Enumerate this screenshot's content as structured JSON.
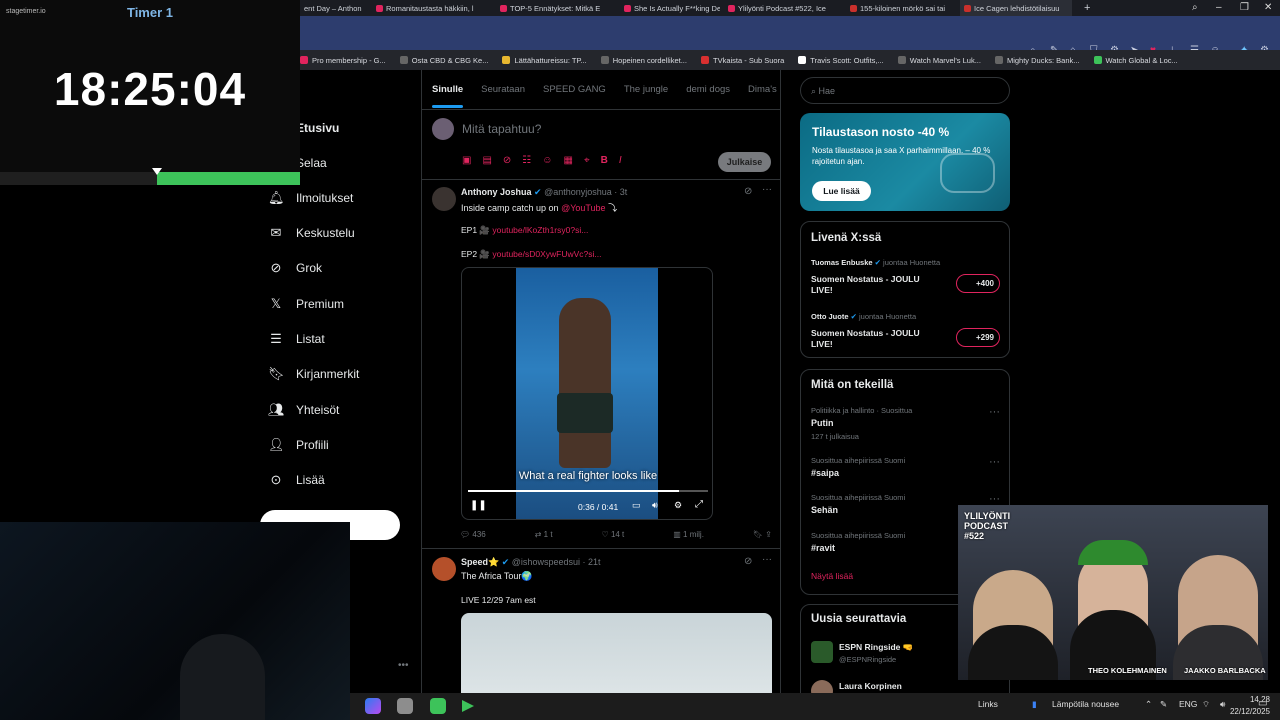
{
  "browser": {
    "tabs": [
      {
        "label": "ent Day – Anthon"
      },
      {
        "label": "Romanitaustasta häkkiin, l"
      },
      {
        "label": "TOP-5 Ennätykset: Mitkä E"
      },
      {
        "label": "She Is Actually F**king De"
      },
      {
        "label": "Ylilyönti Podcast #522, Ice"
      },
      {
        "label": "155-kiloinen mörkö sai tai"
      },
      {
        "label": "Ice Cagen lehdistötilaisuu"
      }
    ],
    "new_tab": "+",
    "bookmarks": [
      "Pro membership - G...",
      "Osta CBD & CBG Ke...",
      "Lättähattureissu: TP...",
      "Hopeinen cordelliket...",
      "TVkaista - Sub Suora",
      "Travis Scott: Outfits,...",
      "Watch Marvel's Luk...",
      "Mighty Ducks: Bank...",
      "Watch Global & Loc..."
    ]
  },
  "timer_overlay": {
    "logo": "stagetimer.io",
    "title": "Timer 1",
    "time": "18:25:04",
    "progress_fraction": 0.48
  },
  "sidebar": {
    "items": [
      {
        "label": "Etusivu",
        "icon": "home-icon"
      },
      {
        "label": "Selaa",
        "icon": "search-icon"
      },
      {
        "label": "Ilmoitukset",
        "icon": "bell-icon"
      },
      {
        "label": "Keskustelu",
        "icon": "mail-icon"
      },
      {
        "label": "Grok",
        "icon": "grok-icon"
      },
      {
        "label": "Premium",
        "icon": "x-logo-icon"
      },
      {
        "label": "Listat",
        "icon": "list-icon"
      },
      {
        "label": "Kirjanmerkit",
        "icon": "bookmark-icon"
      },
      {
        "label": "Yhteisöt",
        "icon": "people-icon"
      },
      {
        "label": "Profiili",
        "icon": "person-icon"
      },
      {
        "label": "Lisää",
        "icon": "more-circle-icon"
      }
    ]
  },
  "feed": {
    "tabs": [
      "Sinulle",
      "Seurataan",
      "SPEED GANG",
      "The jungle",
      "demi dogs",
      "Dima's DI"
    ],
    "compose_placeholder": "Mitä tapahtuu?",
    "compose_button": "Julkaise",
    "post1": {
      "author": "Anthony Joshua",
      "handle": "@anthonyjoshua · 3t",
      "text_prefix": "Inside camp catch up on ",
      "text_link": "@YouTube",
      "text_suffix": " ⤵",
      "ep1_label": "EP1 🎥",
      "ep1_link": "youtube/lKoZth1rsy0?si...",
      "ep2_label": "EP2 🎥",
      "ep2_link": "youtube/sD0XywFUwVc?si...",
      "video_subtitle": "What a real fighter looks like",
      "video_time": "0:36 / 0:41",
      "video_progress": 0.88,
      "replies": "436",
      "reposts": "1 t",
      "likes": "14 t",
      "views": "1 milj."
    },
    "post2": {
      "author": "Speed⭐",
      "handle": "@ishowspeedsui · 21t",
      "text": "The Africa Tour🌍",
      "sub": "LIVE 12/29 7am est"
    }
  },
  "right": {
    "search_placeholder": "Hae",
    "promo": {
      "title": "Tilaustason nosto -40 %",
      "body": "Nosta tilaustasoa ja saa X parhaimmillaan. – 40 % rajoitetun ajan.",
      "button": "Lue lisää"
    },
    "live": {
      "title": "Livenä X:ssä",
      "items": [
        {
          "host": "Tuomas Enbuske",
          "hosting": "juontaa Huonetta",
          "title": "Suomen Nostatus - JOULU LIVE!",
          "count": "+400"
        },
        {
          "host": "Otto Juote",
          "hosting": "juontaa Huonetta",
          "title": "Suomen Nostatus - JOULU LIVE!",
          "count": "+299"
        }
      ]
    },
    "trends": {
      "title": "Mitä on tekeillä",
      "items": [
        {
          "context": "Politiikka ja hallinto · Suosittua",
          "name": "Putin",
          "count": "127 t julkaisua"
        },
        {
          "context": "Suosittua aihepiirissä Suomi",
          "name": "#saipa",
          "count": ""
        },
        {
          "context": "Suosittua aihepiirissä Suomi",
          "name": "Sehän",
          "count": ""
        },
        {
          "context": "Suosittua aihepiirissä Suomi",
          "name": "#ravit",
          "count": ""
        }
      ],
      "show_more": "Näytä lisää"
    },
    "follow": {
      "title": "Uusia seurattavia",
      "items": [
        {
          "name": "ESPN Ringside 🤜",
          "handle": "@ESPNRingside"
        },
        {
          "name": "Laura Korpinen",
          "handle": ""
        }
      ]
    }
  },
  "stream_overlay": {
    "title": "YLILYÖNTI PODCAST #522",
    "caption_left": "THEO KOLEHMAINEN",
    "caption_right": "JAAKKO BARLBACKA"
  },
  "taskbar": {
    "links": "Links",
    "weather": "Lämpötila nousee",
    "lang": "ENG",
    "time": "14.28",
    "date": "22/12/2025"
  },
  "colors": {
    "accent": "#e0245e",
    "blue": "#1d9bf0",
    "green": "#3dc35a"
  }
}
